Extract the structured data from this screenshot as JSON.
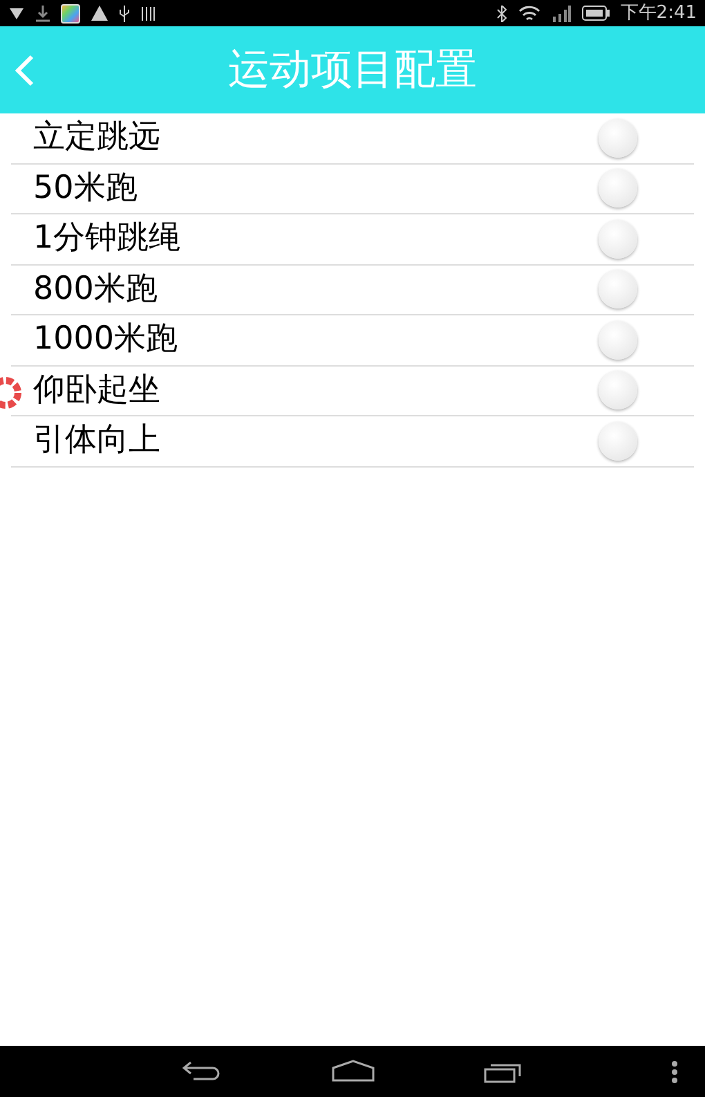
{
  "status_bar": {
    "time": "下午2:41"
  },
  "header": {
    "title": "运动项目配置"
  },
  "items": [
    {
      "label": "立定跳远",
      "checked": false
    },
    {
      "label": "50米跑",
      "checked": false
    },
    {
      "label": "1分钟跳绳",
      "checked": false
    },
    {
      "label": "800米跑",
      "checked": false
    },
    {
      "label": "1000米跑",
      "checked": false
    },
    {
      "label": "仰卧起坐",
      "checked": false
    },
    {
      "label": "引体向上",
      "checked": false
    }
  ]
}
